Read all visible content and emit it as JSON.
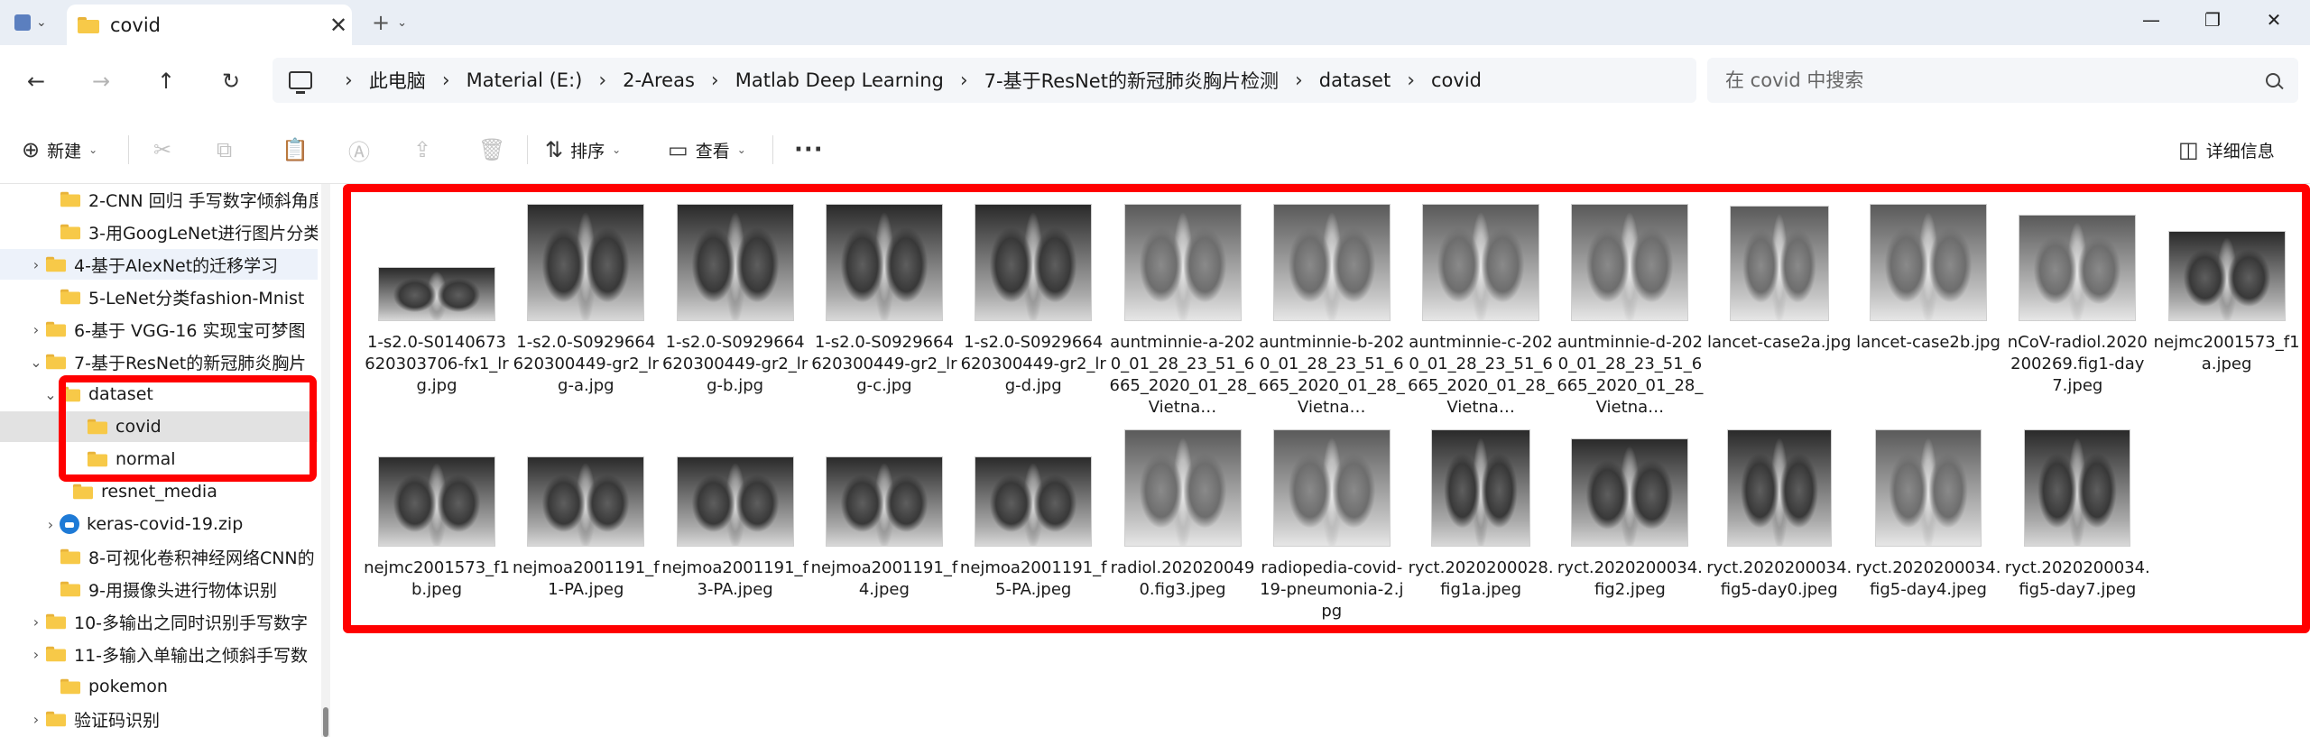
{
  "window": {
    "tab_title": "covid",
    "new_tab": "+",
    "close_tab": "✕",
    "minimize": "—",
    "maximize": "❐",
    "close": "✕"
  },
  "nav": {
    "back": "←",
    "forward": "→",
    "up": "↑",
    "refresh": "↻"
  },
  "address": {
    "crumbs": [
      "此电脑",
      "Material (E:)",
      "2-Areas",
      "Matlab Deep Learning",
      "7-基于ResNet的新冠肺炎胸片检测",
      "dataset",
      "covid"
    ],
    "separator": "›"
  },
  "search": {
    "placeholder": "在 covid 中搜索"
  },
  "toolbar": {
    "new_label": "新建",
    "sort_label": "排序",
    "view_label": "查看",
    "more": "···",
    "details_label": "详细信息"
  },
  "sidebar": {
    "items": [
      {
        "label": "2-CNN 回归 手写数字倾斜角度"
      },
      {
        "label": "3-用GoogLeNet进行图片分类"
      },
      {
        "label": "4-基于AlexNet的迁移学习"
      },
      {
        "label": "5-LeNet分类fashion-Mnist"
      },
      {
        "label": "6-基于 VGG-16 实现宝可梦图"
      },
      {
        "label": "7-基于ResNet的新冠肺炎胸片"
      },
      {
        "label": "dataset"
      },
      {
        "label": "covid"
      },
      {
        "label": "normal"
      },
      {
        "label": "resnet_media"
      },
      {
        "label": "keras-covid-19.zip"
      },
      {
        "label": "8-可视化卷积神经网络CNN的"
      },
      {
        "label": "9-用摄像头进行物体识别"
      },
      {
        "label": "10-多输出之同时识别手写数字"
      },
      {
        "label": "11-多输入单输出之倾斜手写数"
      },
      {
        "label": "pokemon"
      },
      {
        "label": "验证码识别"
      }
    ]
  },
  "files": [
    {
      "name": "1-s2.0-S0140673620303706-fx1_lrg.jpg"
    },
    {
      "name": "1-s2.0-S0929664620300449-gr2_lrg-a.jpg"
    },
    {
      "name": "1-s2.0-S0929664620300449-gr2_lrg-b.jpg"
    },
    {
      "name": "1-s2.0-S0929664620300449-gr2_lrg-c.jpg"
    },
    {
      "name": "1-s2.0-S0929664620300449-gr2_lrg-d.jpg"
    },
    {
      "name": "auntminnie-a-2020_01_28_23_51_6665_2020_01_28_Vietna…"
    },
    {
      "name": "auntminnie-b-2020_01_28_23_51_6665_2020_01_28_Vietna…"
    },
    {
      "name": "auntminnie-c-2020_01_28_23_51_6665_2020_01_28_Vietna…"
    },
    {
      "name": "auntminnie-d-2020_01_28_23_51_6665_2020_01_28_Vietna…"
    },
    {
      "name": "lancet-case2a.jpg"
    },
    {
      "name": "lancet-case2b.jpg"
    },
    {
      "name": "nCoV-radiol.2020200269.fig1-day7.jpeg"
    },
    {
      "name": "nejmc2001573_f1a.jpeg"
    },
    {
      "name": "nejmc2001573_f1b.jpeg"
    },
    {
      "name": "nejmoa2001191_f1-PA.jpeg"
    },
    {
      "name": "nejmoa2001191_f3-PA.jpeg"
    },
    {
      "name": "nejmoa2001191_f4.jpeg"
    },
    {
      "name": "nejmoa2001191_f5-PA.jpeg"
    },
    {
      "name": "radiol.2020200490.fig3.jpeg"
    },
    {
      "name": "radiopedia-covid-19-pneumonia-2.jpg"
    },
    {
      "name": "ryct.2020200028.fig1a.jpeg"
    },
    {
      "name": "ryct.2020200034.fig2.jpeg"
    },
    {
      "name": "ryct.2020200034.fig5-day0.jpeg"
    },
    {
      "name": "ryct.2020200034.fig5-day4.jpeg"
    },
    {
      "name": "ryct.2020200034.fig5-day7.jpeg"
    }
  ]
}
